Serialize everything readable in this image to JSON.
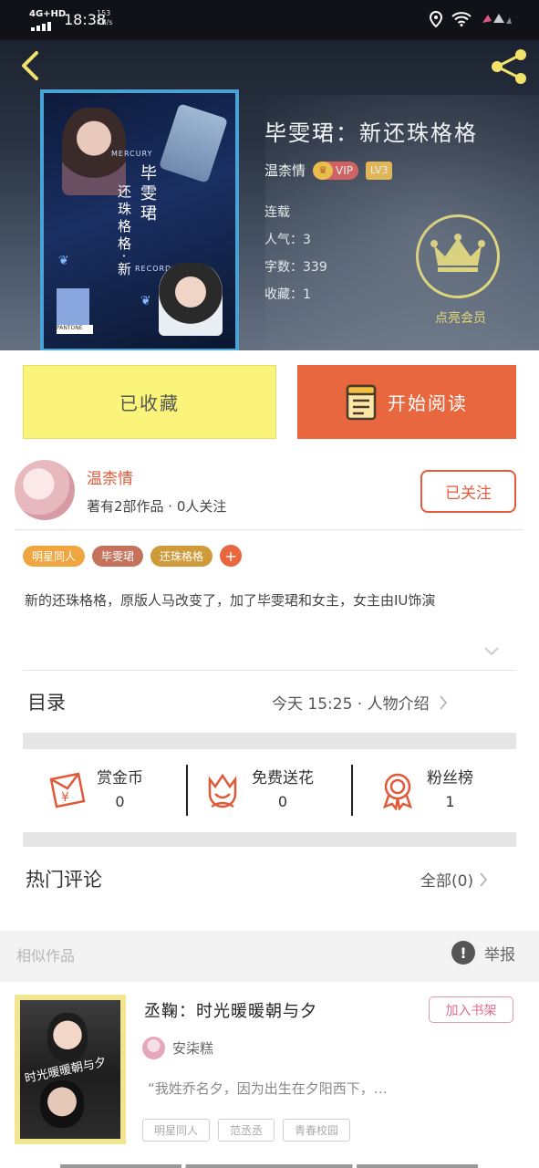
{
  "status_bar": {
    "network": "4G+HD",
    "time": "18:38",
    "speed_value": "153",
    "speed_unit": "KB/s"
  },
  "book": {
    "title": "毕雯珺：新还珠格格",
    "author": "温柰情",
    "vip_label": "VIP",
    "level": "LV3",
    "status": "连载",
    "popularity": "人气：3",
    "word_count": "字数：339",
    "favorites": "收藏：1",
    "member_label": "点亮会员",
    "cover_text": {
      "col1": "毕雯珺",
      "col2": "还珠格格·新",
      "brand": "MERCURY",
      "record": "RECORD",
      "pantone": "PANTONE"
    }
  },
  "actions": {
    "collected_label": "已收藏",
    "read_label": "开始阅读"
  },
  "author_section": {
    "name": "温柰情",
    "works": "著有2部作品 · 0人关注",
    "follow_label": "已关注"
  },
  "tags": [
    {
      "label": "明星同人",
      "color": "#f0a640"
    },
    {
      "label": "毕雯珺",
      "color": "#c5725c"
    },
    {
      "label": "还珠格格",
      "color": "#cf9a3a"
    }
  ],
  "description": "新的还珠格格，原版人马改变了，加了毕雯珺和女主，女主由IU饰演",
  "toc": {
    "label": "目录",
    "right": "今天 15:25 · 人物介绍"
  },
  "stats": [
    {
      "label": "赏金币",
      "value": "0",
      "icon": "red-envelope-icon"
    },
    {
      "label": "免费送花",
      "value": "0",
      "icon": "flower-icon"
    },
    {
      "label": "粉丝榜",
      "value": "1",
      "icon": "medal-icon"
    }
  ],
  "comments": {
    "label": "热门评论",
    "all_label": "全部(0)"
  },
  "similar": {
    "label": "相似作品",
    "report_label": "举报",
    "item": {
      "title": "丞鞠：时光暖暖朝与夕",
      "add_label": "加入书架",
      "author": "安柒糕",
      "excerpt": "“我姓乔名夕，因为出生在夕阳西下，…",
      "tags": [
        "明星同人",
        "范丞丞",
        "青春校园"
      ],
      "cover_text": "时光暖暖朝与夕"
    }
  },
  "colors": {
    "accent": "#e9673e",
    "collected_bg": "#faf57a",
    "member_yellow": "#f1e26a"
  }
}
